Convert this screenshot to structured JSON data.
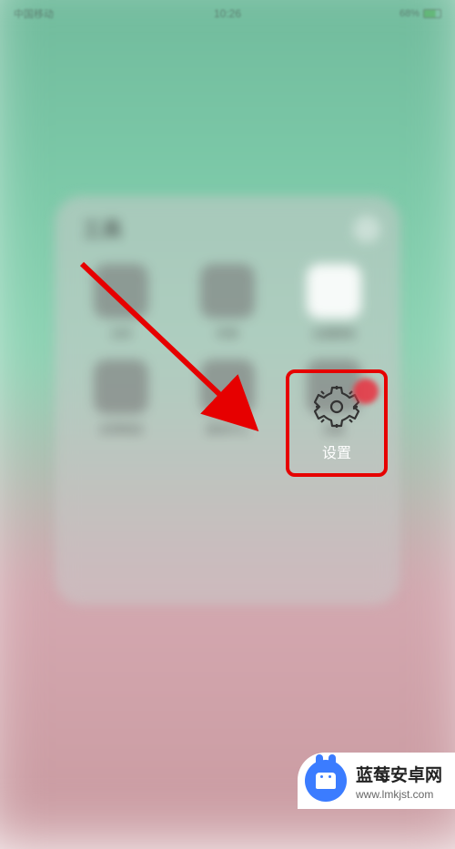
{
  "status": {
    "carrier": "中国移动",
    "time": "10:26",
    "battery_pct": "68%"
  },
  "folder": {
    "title": "工具",
    "apps": [
      {
        "label": "日历"
      },
      {
        "label": "时钟"
      },
      {
        "label": "主题壁纸"
      },
      {
        "label": "应用商店"
      },
      {
        "label": "游戏中心"
      },
      {
        "label": "设置"
      }
    ]
  },
  "highlight": {
    "label": "设置"
  },
  "watermark": {
    "title": "蓝莓安卓网",
    "url": "www.lmkjst.com"
  },
  "icons": {
    "gear": "gear-icon",
    "android": "android-icon"
  },
  "colors": {
    "highlight_border": "#e60000",
    "arrow": "#e60000",
    "brand": "#3b7cff"
  }
}
